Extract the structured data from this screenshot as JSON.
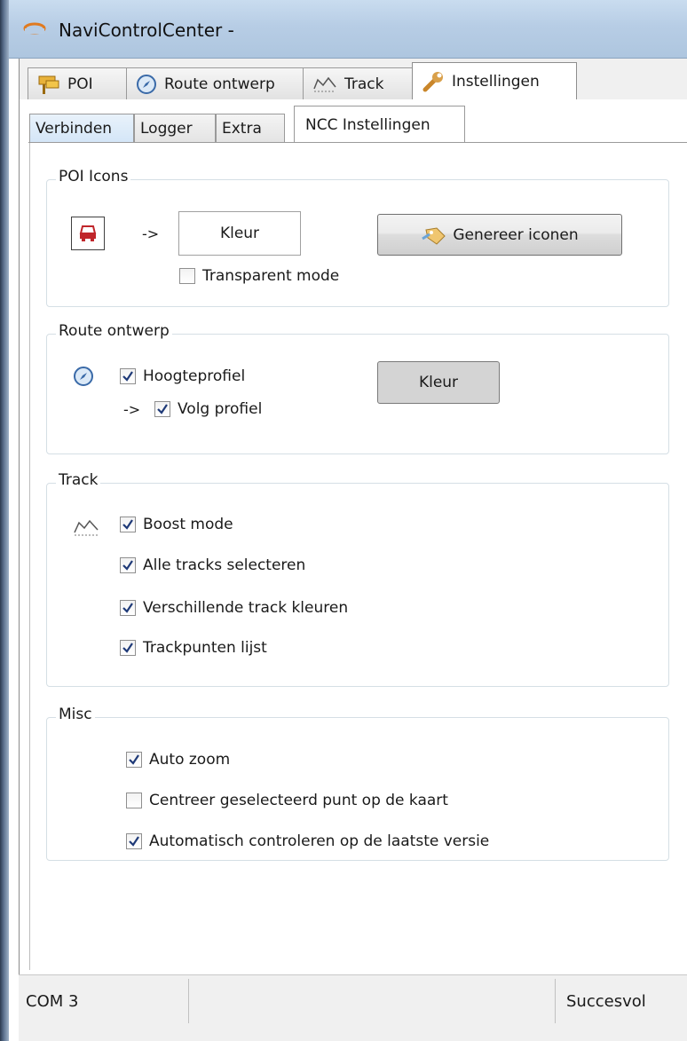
{
  "window": {
    "title": "NaviControlCenter -"
  },
  "main_tabs": [
    {
      "label": "POI",
      "icon": "poi-sign-icon"
    },
    {
      "label": "Route ontwerp",
      "icon": "compass-icon"
    },
    {
      "label": "Track",
      "icon": "track-icon"
    },
    {
      "label": "Instellingen",
      "icon": "wrench-icon",
      "active": true
    }
  ],
  "sub_tabs": [
    {
      "label": "Verbinden"
    },
    {
      "label": "Logger"
    },
    {
      "label": "Extra"
    },
    {
      "label": "NCC Instellingen",
      "active": true
    }
  ],
  "poi_icons": {
    "title": "POI Icons",
    "arrow": "->",
    "color_label": "Kleur",
    "generate_button": "Genereer iconen",
    "transparent_mode": {
      "label": "Transparent mode",
      "checked": false
    }
  },
  "route_ontwerp": {
    "title": "Route ontwerp",
    "hoogteprofiel": {
      "label": "Hoogteprofiel",
      "checked": true
    },
    "arrow": "->",
    "volg_profiel": {
      "label": "Volg profiel",
      "checked": true
    },
    "color_button": "Kleur"
  },
  "track": {
    "title": "Track",
    "options": [
      {
        "label": "Boost mode",
        "checked": true
      },
      {
        "label": "Alle tracks selecteren",
        "checked": true
      },
      {
        "label": "Verschillende track kleuren",
        "checked": true
      },
      {
        "label": "Trackpunten lijst",
        "checked": true
      }
    ]
  },
  "misc": {
    "title": "Misc",
    "options": [
      {
        "label": "Auto zoom",
        "checked": true
      },
      {
        "label": "Centreer geselecteerd punt op de kaart",
        "checked": false
      },
      {
        "label": "Automatisch controleren op de laatste versie",
        "checked": true
      }
    ]
  },
  "status_bar": {
    "port": "COM 3",
    "state": "Succesvol"
  }
}
